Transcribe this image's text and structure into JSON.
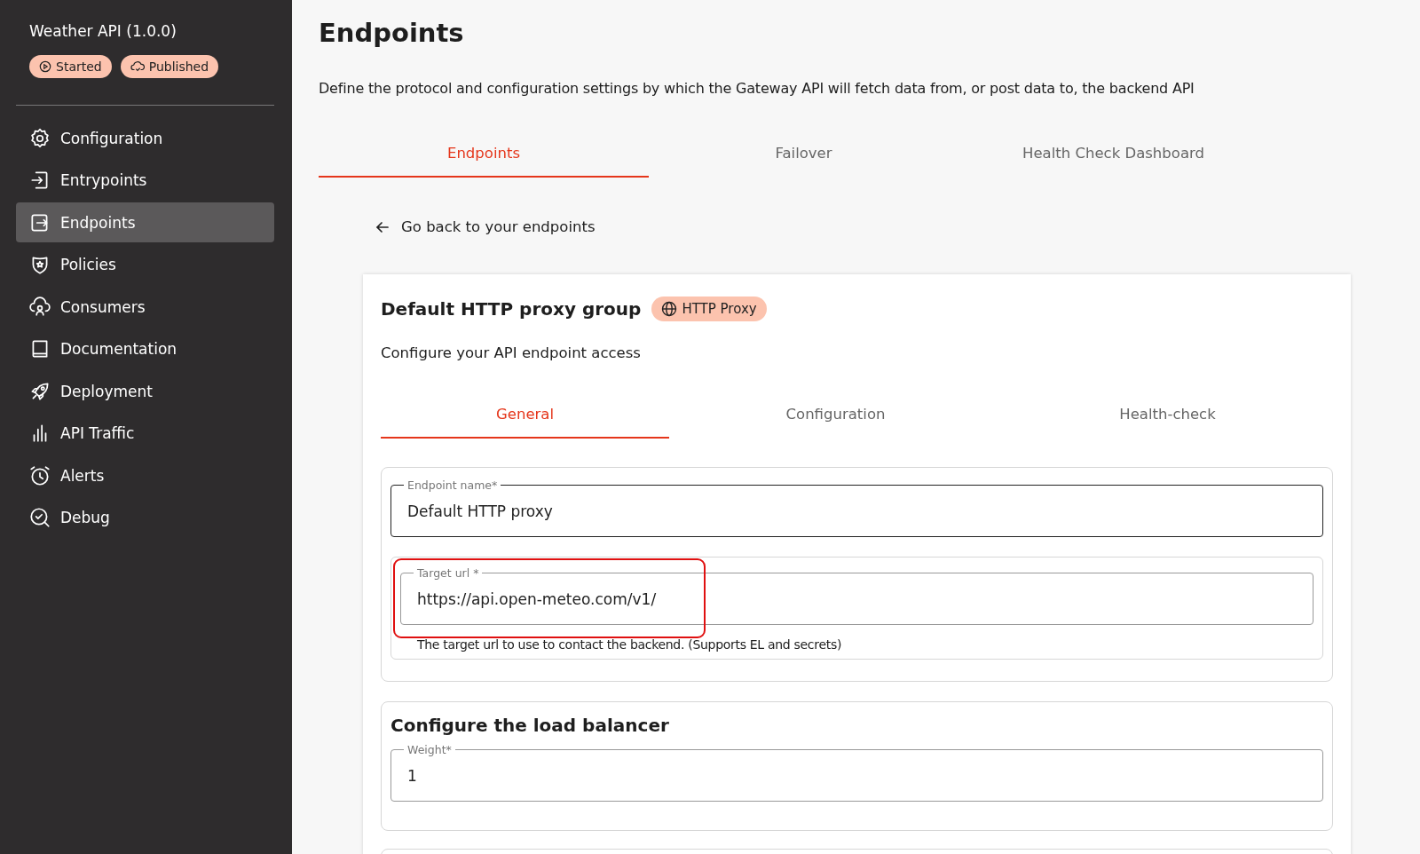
{
  "sidebar": {
    "title": "Weather API (1.0.0)",
    "badges": [
      {
        "kind": "started",
        "label": "Started"
      },
      {
        "kind": "published",
        "label": "Published"
      }
    ],
    "items": [
      {
        "label": "Configuration",
        "selected": false
      },
      {
        "label": "Entrypoints",
        "selected": false
      },
      {
        "label": "Endpoints",
        "selected": true
      },
      {
        "label": "Policies",
        "selected": false
      },
      {
        "label": "Consumers",
        "selected": false
      },
      {
        "label": "Documentation",
        "selected": false
      },
      {
        "label": "Deployment",
        "selected": false
      },
      {
        "label": "API Traffic",
        "selected": false
      },
      {
        "label": "Alerts",
        "selected": false
      },
      {
        "label": "Debug",
        "selected": false
      }
    ]
  },
  "page": {
    "title": "Endpoints",
    "description": "Define the protocol and configuration settings by which the Gateway API will fetch data from, or post data to, the backend API"
  },
  "tabs": [
    {
      "label": "Endpoints",
      "selected": true
    },
    {
      "label": "Failover",
      "selected": false
    },
    {
      "label": "Health Check Dashboard",
      "selected": false
    }
  ],
  "back_link": "Go back to your endpoints",
  "group": {
    "title": "Default HTTP proxy group",
    "badge": "HTTP Proxy",
    "subtitle": "Configure your API endpoint access",
    "tabs": [
      {
        "label": "General",
        "selected": true
      },
      {
        "label": "Configuration",
        "selected": false
      },
      {
        "label": "Health-check",
        "selected": false
      }
    ],
    "endpoint_name": {
      "label": "Endpoint name*",
      "value": "Default HTTP proxy"
    },
    "target_url": {
      "label": "Target url *",
      "value": "https://api.open-meteo.com/v1/",
      "hint": "The target url to use to contact the backend. (Supports EL and secrets)",
      "highlighted": true
    },
    "load_balancer": {
      "title": "Configure the load balancer",
      "weight": {
        "label": "Weight*",
        "value": "1"
      }
    }
  }
}
